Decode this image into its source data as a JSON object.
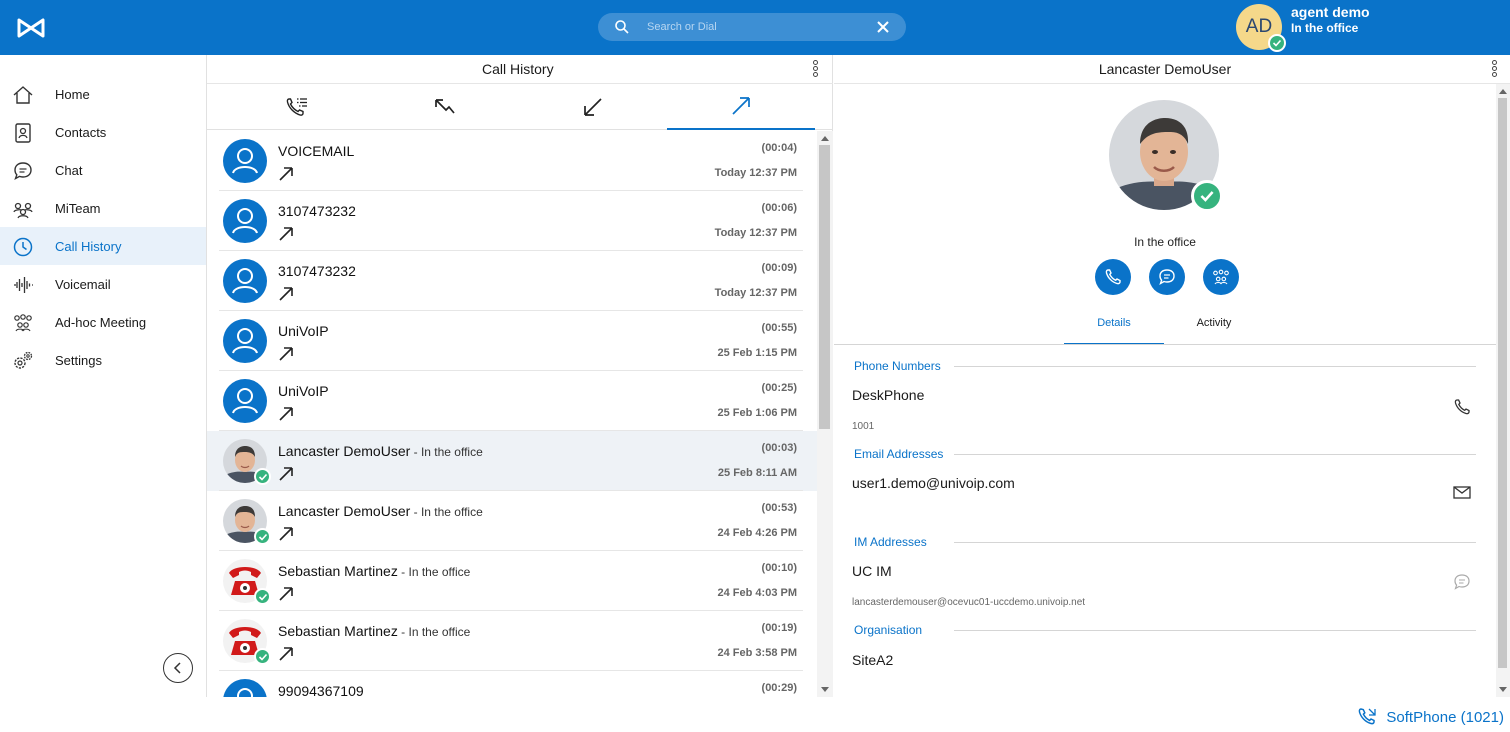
{
  "app": {
    "brand_color": "#0a73c9",
    "presence_color": "#36b37e"
  },
  "search": {
    "placeholder": "Search or Dial"
  },
  "user": {
    "initials": "AD",
    "name": "agent demo",
    "status": "In the office"
  },
  "sidebar": {
    "items": [
      {
        "label": "Home",
        "icon": "home-icon"
      },
      {
        "label": "Contacts",
        "icon": "contacts-icon"
      },
      {
        "label": "Chat",
        "icon": "chat-icon"
      },
      {
        "label": "MiTeam",
        "icon": "team-icon"
      },
      {
        "label": "Call History",
        "icon": "clock-icon",
        "active": true
      },
      {
        "label": "Voicemail",
        "icon": "voicemail-icon"
      },
      {
        "label": "Ad-hoc Meeting",
        "icon": "meeting-icon"
      },
      {
        "label": "Settings",
        "icon": "settings-icon"
      }
    ]
  },
  "history": {
    "title": "Call History",
    "tabs": [
      "all-calls",
      "missed",
      "incoming",
      "outgoing"
    ],
    "active_tab": "outgoing",
    "rows": [
      {
        "name": "VOICEMAIL",
        "presence": "",
        "duration": "(00:04)",
        "time": "Today 12:37 PM",
        "avatar": "generic"
      },
      {
        "name": "3107473232",
        "presence": "",
        "duration": "(00:06)",
        "time": "Today 12:37 PM",
        "avatar": "generic"
      },
      {
        "name": "3107473232",
        "presence": "",
        "duration": "(00:09)",
        "time": "Today 12:37 PM",
        "avatar": "generic"
      },
      {
        "name": "UniVoIP",
        "presence": "",
        "duration": "(00:55)",
        "time": "25 Feb 1:15 PM",
        "avatar": "generic"
      },
      {
        "name": "UniVoIP",
        "presence": "",
        "duration": "(00:25)",
        "time": "25 Feb 1:06 PM",
        "avatar": "generic"
      },
      {
        "name": "Lancaster DemoUser",
        "presence": " - In the office",
        "duration": "(00:03)",
        "time": "25 Feb 8:11 AM",
        "avatar": "photo",
        "selected": true
      },
      {
        "name": "Lancaster DemoUser",
        "presence": " - In the office",
        "duration": "(00:53)",
        "time": "24 Feb 4:26 PM",
        "avatar": "photo"
      },
      {
        "name": "Sebastian Martinez",
        "presence": " - In the office",
        "duration": "(00:10)",
        "time": "24 Feb 4:03 PM",
        "avatar": "phone-photo"
      },
      {
        "name": "Sebastian Martinez",
        "presence": " - In the office",
        "duration": "(00:19)",
        "time": "24 Feb 3:58 PM",
        "avatar": "phone-photo"
      },
      {
        "name": "99094367109",
        "presence": "",
        "duration": "(00:29)",
        "time": "",
        "avatar": "generic"
      }
    ]
  },
  "detail": {
    "title": "Lancaster DemoUser",
    "presence": "In the office",
    "tabs": {
      "details": "Details",
      "activity": "Activity"
    },
    "sections": {
      "phone": "Phone Numbers",
      "email": "Email Addresses",
      "im": "IM Addresses",
      "org": "Organisation"
    },
    "phone": {
      "label": "DeskPhone",
      "value": "1001"
    },
    "email": {
      "value": "user1.demo@univoip.com"
    },
    "im": {
      "label": "UC IM",
      "value": "lancasterdemouser@ocevuc01-uccdemo.univoip.net"
    },
    "org": {
      "value": "SiteA2"
    }
  },
  "footer": {
    "softphone": "SoftPhone (1021)"
  }
}
